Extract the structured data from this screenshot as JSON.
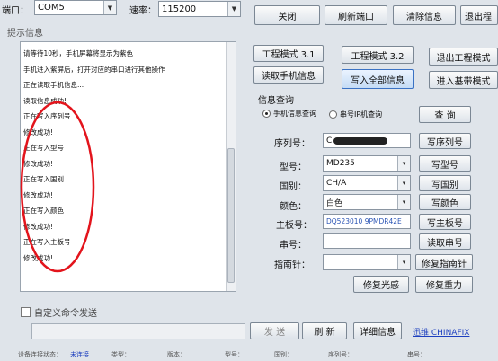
{
  "top": {
    "port_label": "端口：",
    "port_value": "COM5",
    "baud_label": "速率：",
    "baud_value": "115200",
    "buttons": [
      "关闭",
      "刷新端口",
      "清除信息",
      "退出程"
    ]
  },
  "log": {
    "title": "提示信息",
    "lines": [
      "请等待10秒，手机屏幕将显示为紫色",
      "手机进入紫屏后，打开对应的串口进行其他操作",
      "正在读取手机信息...",
      "读取信息成功!",
      "正在写入序列号",
      "修改成功!",
      "正在写入型号",
      "修改成功!",
      "正在写入国别",
      "修改成功!",
      "正在写入颜色",
      "修改成功!",
      "正在写入主板号",
      "修改成功!"
    ]
  },
  "modes": {
    "eng31": "工程模式 3.1",
    "eng32": "工程模式 3.2",
    "exit_eng": "退出工程模式",
    "read_phone": "读取手机信息",
    "write_all": "写入全部信息",
    "enter_basic": "进入基带模式"
  },
  "query": {
    "title": "信息查询",
    "radio1": "手机信息查询",
    "radio2": "串号IP机查询",
    "query_btn": "查 询"
  },
  "fields": {
    "serial_label": "序列号：",
    "serial_value": "C",
    "model_label": "型号：",
    "model_value": "MD235",
    "country_label": "国别：",
    "country_value": "CH/A",
    "color_label": "颜色：",
    "color_value": "白色",
    "board_label": "主板号：",
    "board_value": "DQ523010 9PMDR42E",
    "imei_label": "串号：",
    "imei_value": "",
    "compass_label": "指南针：",
    "compass_value": ""
  },
  "actions": {
    "write_serial": "写序列号",
    "write_model": "写型号",
    "write_country": "写国别",
    "write_color": "写颜色",
    "write_board": "写主板号",
    "read_imei": "读取串号",
    "fix_compass": "修复指南针",
    "fix_light": "修复光感",
    "fix_gravity": "修复重力"
  },
  "bottom": {
    "custom_cmd": "自定义命令发送",
    "send": "发 送",
    "refresh": "刷 新",
    "details": "详细信息",
    "brand": "迅维 CHINAFIX",
    "status": [
      "设备连接状态：",
      "未连接",
      "类型：",
      "版本：",
      "型号：",
      "国别：",
      "序列号：",
      "串号："
    ]
  },
  "colors": {
    "annotation_circle": "#e3141c",
    "link": "#1d3fbf",
    "field_blue": "#2b55b5"
  }
}
